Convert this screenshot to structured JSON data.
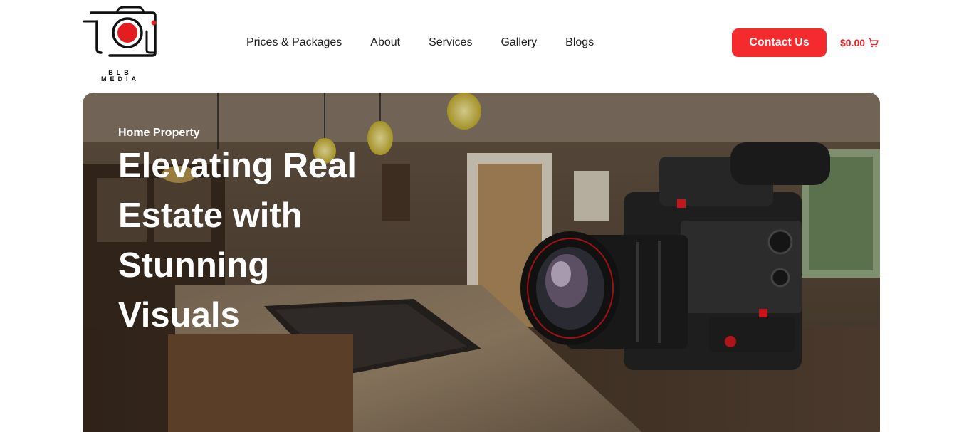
{
  "brand": {
    "logo_line1": "BLB",
    "logo_line2": "MEDIA",
    "accent_color": "#f42a2d"
  },
  "nav": {
    "items": [
      {
        "label": "Prices & Packages"
      },
      {
        "label": "About"
      },
      {
        "label": "Services"
      },
      {
        "label": "Gallery"
      },
      {
        "label": "Blogs"
      }
    ]
  },
  "header": {
    "contact_label": "Contact Us",
    "cart_total": "$0.00",
    "cart_icon": "cart-icon"
  },
  "hero": {
    "kicker": "Home Property",
    "title": "Elevating Real Estate with Stunning Visuals",
    "image": "kitchen-interior-with-cinema-camera"
  }
}
